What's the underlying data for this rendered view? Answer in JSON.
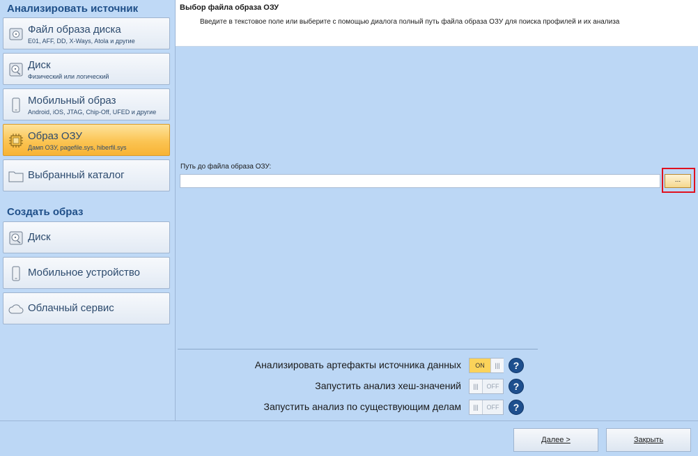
{
  "sidebar": {
    "analyze_title": "Анализировать источник",
    "create_title": "Создать образ",
    "analyze_items": [
      {
        "title": "Файл образа диска",
        "sub": "E01, AFF, DD, X-Ways, Atola и другие",
        "icon": "disk-image-icon"
      },
      {
        "title": "Диск",
        "sub": "Физический или логический",
        "icon": "hard-disk-icon"
      },
      {
        "title": "Мобильный образ",
        "sub": "Android, iOS, JTAG, Chip-Off, UFED и другие",
        "icon": "mobile-image-icon"
      },
      {
        "title": "Образ ОЗУ",
        "sub": "Дамп ОЗУ, pagefile.sys, hiberfil.sys",
        "icon": "ram-chip-icon",
        "active": true
      },
      {
        "title": "Выбранный каталог",
        "sub": "",
        "icon": "folder-icon"
      }
    ],
    "create_items": [
      {
        "title": "Диск",
        "icon": "hard-disk-icon"
      },
      {
        "title": "Мобильное устройство",
        "icon": "mobile-device-icon"
      },
      {
        "title": "Облачный сервис",
        "icon": "cloud-icon"
      }
    ]
  },
  "header": {
    "title": "Выбор файла образа ОЗУ",
    "description": "Введите в текстовое поле или выберите с помощью диалога полный путь файла образа ОЗУ для поиска профилей и их анализа"
  },
  "path": {
    "label": "Путь до файла образа ОЗУ:",
    "value": "",
    "browse_label": "..."
  },
  "options": [
    {
      "label": "Анализировать артефакты источника данных",
      "state": "ON"
    },
    {
      "label": "Запустить анализ хеш-значений",
      "state": "OFF"
    },
    {
      "label": "Запустить анализ по существующим делам",
      "state": "OFF"
    }
  ],
  "toggle_text": {
    "on": "ON",
    "off": "OFF",
    "grip": "|||"
  },
  "help_glyph": "?",
  "footer": {
    "next_label": "Далее >",
    "close_label": "Закрыть"
  },
  "colors": {
    "background": "#bcd7f5",
    "active_item": "#fbc453",
    "highlight": "#e0101e",
    "help": "#1e4f8e"
  }
}
